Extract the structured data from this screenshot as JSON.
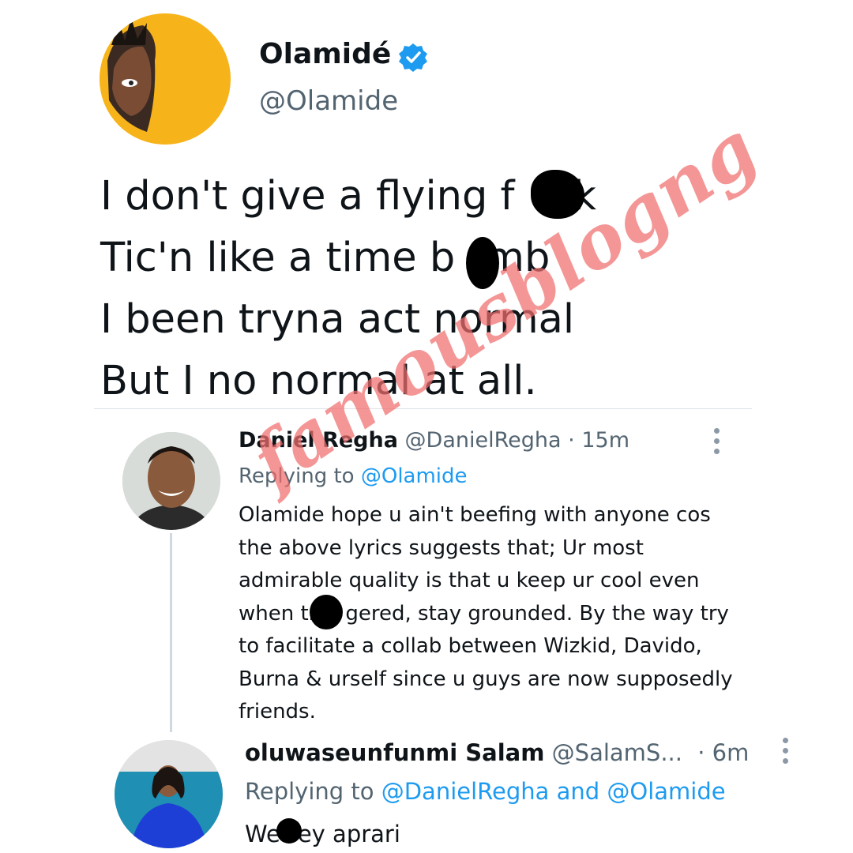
{
  "main_tweet": {
    "display_name": "Olamidé",
    "handle": "@Olamide",
    "lines": [
      "I don't give a flying f",
      "k",
      "Tic'n like a time b",
      "mb",
      "I been tryna act normal",
      "But I no normal at all."
    ]
  },
  "replies": [
    {
      "display_name": "Daniel Regha",
      "handle": "@DanielRegha",
      "time": "· 15m",
      "replying_prefix": "Replying to",
      "replying_to": "@Olamide",
      "body": "Olamide hope u ain't beefing with anyone cos the above lyrics suggests that; Ur most admirable quality is that u keep ur cool even when tr",
      "body_cont": "gered, stay grounded. By the way try to facilitate a collab between Wizkid, Davido, Burna & urself since u guys are now supposedly friends."
    },
    {
      "display_name": "oluwaseunfunmi Salam",
      "handle": "@SalamS...",
      "time": "· 6m",
      "replying_prefix": "Replying to",
      "replying_to_1": "@DanielRegha",
      "and": "and",
      "replying_to_2": "@Olamide",
      "body_start": "We",
      "body_end": "ey aprari"
    }
  ],
  "watermark": "famousblogng",
  "colors": {
    "accent": "#1d9bf0",
    "muted": "#536471",
    "avatar_bg": "#f7b31a",
    "watermark": "#f06e6e"
  },
  "icons": [
    "verified-badge-icon",
    "more-options-icon"
  ]
}
